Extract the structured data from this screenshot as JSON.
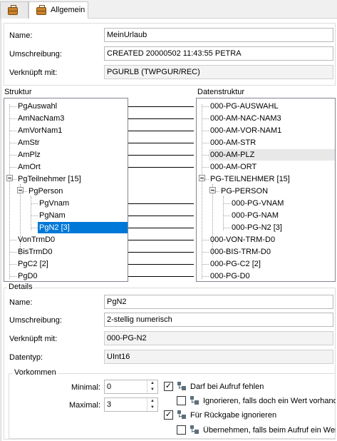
{
  "tabs": [
    {
      "label": "",
      "icon": "briefcase-icon"
    },
    {
      "label": "Allgemein",
      "icon": "briefcase-icon"
    }
  ],
  "header": {
    "name_label": "Name:",
    "name_value": "MeinUrlaub",
    "desc_label": "Umschreibung:",
    "desc_value": "CREATED  20000502 11:43:55 PETRA",
    "linked_label": "Verknüpft mit:",
    "linked_value": "PGURLB (TWPGUR/REC)"
  },
  "struktur": {
    "label": "Struktur",
    "nodes": [
      "PgAuswahl",
      "AmNacNam3",
      "AmVorNam1",
      "AmStr",
      "AmPlz",
      "AmOrt",
      "PgTeilnehmer [15]",
      "PgPerson",
      "PgVnam",
      "PgNam",
      "PgN2 [3]",
      "VonTrmD0",
      "BisTrmD0",
      "PgC2 [2]",
      "PgD0"
    ]
  },
  "datenstruktur": {
    "label": "Datenstruktur",
    "nodes": [
      "000-PG-AUSWAHL",
      "000-AM-NAC-NAM3",
      "000-AM-VOR-NAM1",
      "000-AM-STR",
      "000-AM-PLZ",
      "000-AM-ORT",
      "PG-TEILNEHMER [15]",
      "PG-PERSON",
      "000-PG-VNAM",
      "000-PG-NAM",
      "000-PG-N2 [3]",
      "000-VON-TRM-D0",
      "000-BIS-TRM-D0",
      "000-PG-C2 [2]",
      "000-PG-D0"
    ]
  },
  "details": {
    "legend": "Details",
    "name_label": "Name:",
    "name_value": "PgN2",
    "desc_label": "Umschreibung:",
    "desc_value": "2-stellig numerisch",
    "linked_label": "Verknüpft mit:",
    "linked_value": "000-PG-N2",
    "type_label": "Datentyp:",
    "type_value": "UInt16"
  },
  "vorkommen": {
    "legend": "Vorkommen",
    "min_label": "Minimal:",
    "min_value": "0",
    "max_label": "Maximal:",
    "max_value": "3",
    "opt1": "Darf bei Aufruf fehlen",
    "opt1_checked": "✓",
    "opt2": "Ignorieren, falls doch ein Wert vorhanden",
    "opt2_checked": "",
    "opt3": "Für Rückgabe ignorieren",
    "opt3_checked": "✓",
    "opt4": "Übernehmen, falls beim Aufruf ein Wert",
    "opt4_checked": ""
  }
}
